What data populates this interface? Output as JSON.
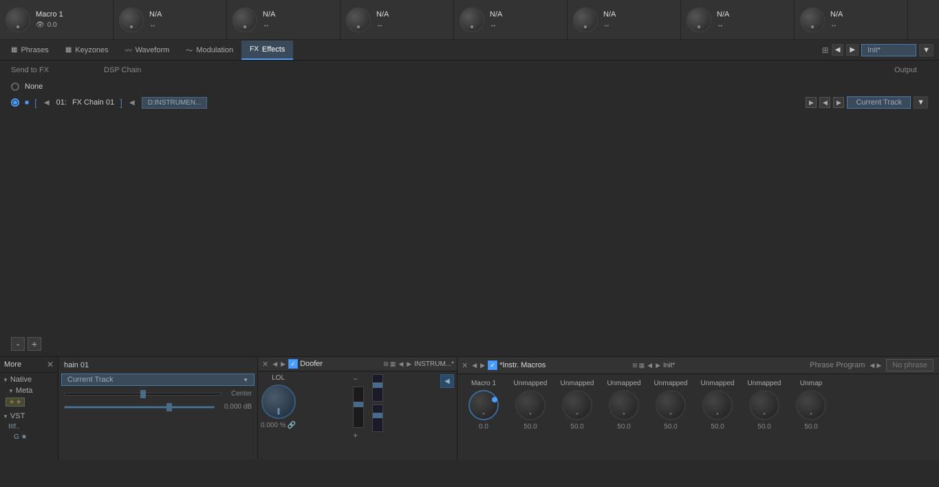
{
  "macroBar": {
    "items": [
      {
        "label": "Macro 1",
        "value": "0.0",
        "icon": "👁"
      },
      {
        "label": "N/A",
        "value": "↔",
        "icon": ""
      },
      {
        "label": "N/A",
        "value": "↔",
        "icon": ""
      },
      {
        "label": "N/A",
        "value": "↔",
        "icon": ""
      },
      {
        "label": "N/A",
        "value": "↔",
        "icon": ""
      },
      {
        "label": "N/A",
        "value": "↔",
        "icon": ""
      },
      {
        "label": "N/A",
        "value": "↔",
        "icon": ""
      },
      {
        "label": "N/A",
        "value": "↔",
        "icon": ""
      }
    ]
  },
  "tabs": {
    "items": [
      {
        "label": "Phrases",
        "icon": "▦",
        "active": false
      },
      {
        "label": "Keyzones",
        "icon": "▦",
        "active": false
      },
      {
        "label": "Waveform",
        "icon": "〰",
        "active": false
      },
      {
        "label": "Modulation",
        "icon": "〜",
        "active": false
      },
      {
        "label": "Effects",
        "icon": "FX",
        "active": true
      }
    ],
    "rightLabel": "Init*",
    "navLeft": "◀",
    "navRight": "▶",
    "dropdownArrow": "▼"
  },
  "effectsPanel": {
    "sendToFX": "Send to FX",
    "dspChain": "DSP Chain",
    "output": "Output",
    "noneLabel": "None",
    "chainRow": {
      "id": "01:",
      "name": "FX Chain 01",
      "path": "D:INSTRUMEN...",
      "currentTrack": "Current Track"
    },
    "addBtn": "+",
    "removeBtn": "-"
  },
  "bottomPanel": {
    "sidebar": {
      "title": "More",
      "closeIcon": "✕",
      "native": {
        "label": "Native",
        "meta": "Meta",
        "stars": "★ ★"
      },
      "vst": {
        "label": "VST",
        "item": "IIIf..",
        "subItem": "G ★"
      }
    },
    "fxChain": {
      "label": "hain 01",
      "currentTrack": "Current Track",
      "panCenter": "Center",
      "volumeDb": "0.000 dB",
      "dropdownArrow": "▼"
    },
    "doofer": {
      "title": "Doofer",
      "pathLabel": "INSTRUM...*",
      "knobLabel": "LOL",
      "knobValue": "0.000 %",
      "backArrow": "◀"
    },
    "instrMacros": {
      "title": "*Instr. Macros",
      "initLabel": "Init*",
      "phraseProgram": "Phrase Program",
      "noPhrase": "No phrase",
      "macros": [
        {
          "label": "Macro 1",
          "value": "0.0"
        },
        {
          "label": "Unmapped",
          "value": "50.0"
        },
        {
          "label": "Unmapped",
          "value": "50.0"
        },
        {
          "label": "Unmapped",
          "value": "50.0"
        },
        {
          "label": "Unmapped",
          "value": "50.0"
        },
        {
          "label": "Unmapped",
          "value": "50.0"
        },
        {
          "label": "Unmapped",
          "value": "50.0"
        },
        {
          "label": "Unmap",
          "value": "50.0"
        }
      ]
    }
  }
}
